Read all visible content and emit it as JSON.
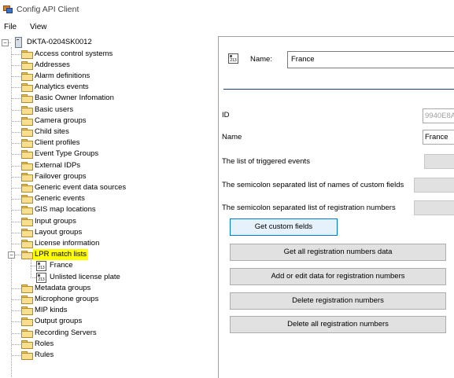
{
  "window": {
    "title": "Config API Client"
  },
  "menu": [
    {
      "label": "File"
    },
    {
      "label": "View"
    }
  ],
  "tree": {
    "root": {
      "label": "DKTA-0204SK0012"
    },
    "items": [
      {
        "label": "Access control systems"
      },
      {
        "label": "Addresses"
      },
      {
        "label": "Alarm definitions"
      },
      {
        "label": "Analytics events"
      },
      {
        "label": "Basic Owner Infomation"
      },
      {
        "label": "Basic users"
      },
      {
        "label": "Camera groups"
      },
      {
        "label": "Child sites"
      },
      {
        "label": "Client profiles"
      },
      {
        "label": "Event Type Groups"
      },
      {
        "label": "External IDPs"
      },
      {
        "label": "Failover groups"
      },
      {
        "label": "Generic event data sources"
      },
      {
        "label": "Generic events"
      },
      {
        "label": "GIS map locations"
      },
      {
        "label": "Input groups"
      },
      {
        "label": "Layout groups"
      },
      {
        "label": "License information"
      },
      {
        "label": "LPR match lists",
        "highlighted": true,
        "expanded": true
      },
      {
        "label": "France",
        "child": true,
        "icon": "license-plate-icon"
      },
      {
        "label": "Unlisted license plate",
        "child": true,
        "icon": "license-plate-icon"
      },
      {
        "label": "Metadata groups"
      },
      {
        "label": "Microphone groups"
      },
      {
        "label": "MIP kinds"
      },
      {
        "label": "Output groups"
      },
      {
        "label": "Recording Servers"
      },
      {
        "label": "Roles"
      },
      {
        "label": "Rules"
      }
    ]
  },
  "detail": {
    "name_label": "Name:",
    "name_value": "France",
    "properties": {
      "id_label": "ID",
      "id_value": "9940E8A",
      "name_label": "Name",
      "name_value": "France",
      "triggered_label": "The list of triggered events",
      "custom_fields_label": "The semicolon separated list of names of custom fields",
      "registration_label": "The semicolon separated list of registration numbers"
    },
    "buttons": {
      "get_custom_fields": "Get custom fields",
      "get_all_data": "Get all registration numbers data",
      "add_edit": "Add or edit data for registration numbers",
      "delete": "Delete registration numbers",
      "delete_all": "Delete all registration numbers"
    }
  },
  "colors": {
    "highlight": "#ffff00",
    "separator": "#1f3a7a",
    "button_focus": "#0078d7"
  }
}
